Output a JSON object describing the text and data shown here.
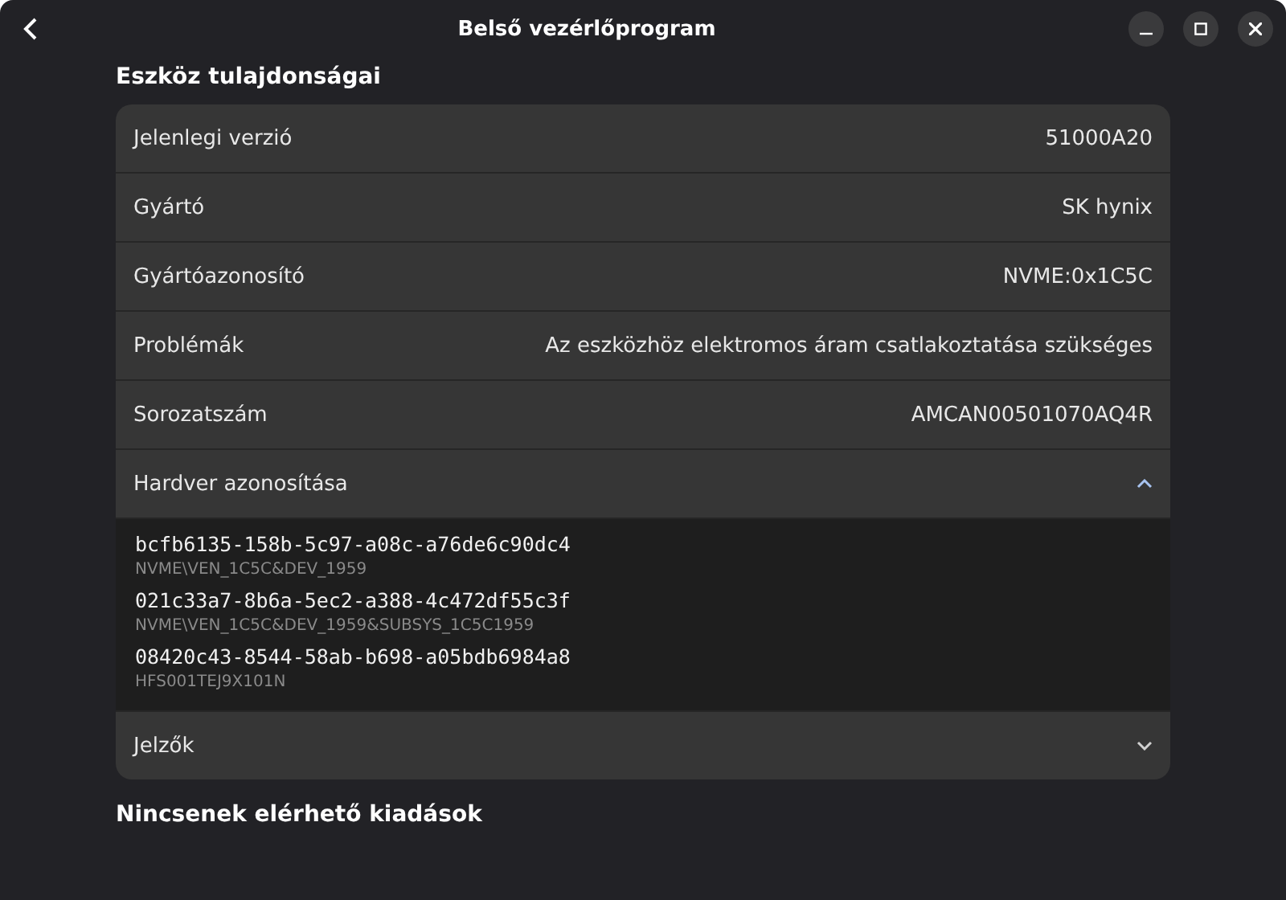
{
  "window": {
    "title": "Belső vezérlőprogram"
  },
  "section_title": "Eszköz tulajdonságai",
  "rows": [
    {
      "kind": "property",
      "label": "Jelenlegi verzió",
      "value": "51000A20"
    },
    {
      "kind": "property",
      "label": "Gyártó",
      "value": "SK hynix"
    },
    {
      "kind": "property",
      "label": "Gyártóazonosító",
      "value": "NVME:0x1C5C"
    },
    {
      "kind": "property",
      "label": "Problémák",
      "value": "Az eszközhöz elektromos áram csatlakoztatása szükséges"
    },
    {
      "kind": "property",
      "label": "Sorozatszám",
      "value": "AMCAN00501070AQ4R"
    },
    {
      "kind": "expander",
      "label": "Hardver azonosítása",
      "expanded": true,
      "items": [
        {
          "guid": "bcfb6135-158b-5c97-a08c-a76de6c90dc4",
          "instance": "NVME\\VEN_1C5C&DEV_1959"
        },
        {
          "guid": "021c33a7-8b6a-5ec2-a388-4c472df55c3f",
          "instance": "NVME\\VEN_1C5C&DEV_1959&SUBSYS_1C5C1959"
        },
        {
          "guid": "08420c43-8544-58ab-b698-a05bdb6984a8",
          "instance": "HFS001TEJ9X101N"
        }
      ]
    },
    {
      "kind": "expander",
      "label": "Jelzők",
      "expanded": false
    }
  ],
  "footer_title": "Nincsenek elérhető kiadások"
}
